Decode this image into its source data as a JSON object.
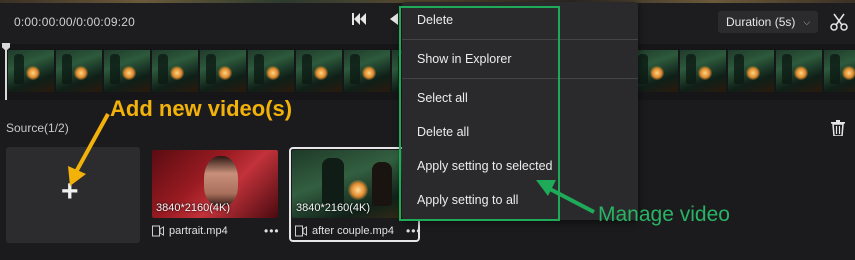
{
  "header": {
    "timecode": "0:00:00:00/0:00:09:20",
    "duration_label": "Duration (5s)"
  },
  "annotations": {
    "add_caption": "Add new video(s)",
    "manage_caption": "Manage video",
    "colors": {
      "add_arrow": "#f2b20a",
      "manage_box": "#1faa59"
    }
  },
  "source": {
    "label": "Source(1/2)",
    "items": [
      {
        "resolution": "3840*2160(4K)",
        "filename": "partrait.mp4",
        "selected": false
      },
      {
        "resolution": "3840*2160(4K)",
        "filename": "after couple.mp4",
        "selected": true
      }
    ]
  },
  "context_menu": {
    "items": [
      "Delete",
      "Show in Explorer",
      "Select all",
      "Delete all",
      "Apply setting to selected",
      "Apply setting to all"
    ]
  },
  "icons": {
    "prev": "skip-back-icon",
    "play": "play-icon",
    "cut": "scissors-icon",
    "trash": "trash-icon",
    "add": "plus-icon",
    "file": "video-file-icon",
    "more": "more-dots-icon"
  }
}
